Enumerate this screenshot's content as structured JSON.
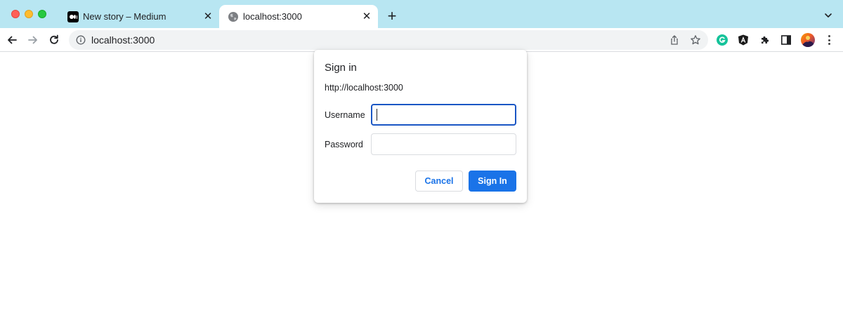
{
  "browser": {
    "tabs": [
      {
        "title": "New story – Medium",
        "favicon": "medium-logo-icon",
        "active": false
      },
      {
        "title": "localhost:3000",
        "favicon": "globe-icon",
        "active": true
      }
    ],
    "new_tab_symbol": "+",
    "close_symbol": "✕",
    "address_bar": {
      "url": "localhost:3000"
    },
    "colors": {
      "tabstrip": "#b8e6f2",
      "accent": "#1a73e8"
    }
  },
  "dialog": {
    "title": "Sign in",
    "origin": "http://localhost:3000",
    "username_label": "Username",
    "username_value": "",
    "password_label": "Password",
    "password_value": "",
    "cancel_label": "Cancel",
    "signin_label": "Sign In"
  }
}
